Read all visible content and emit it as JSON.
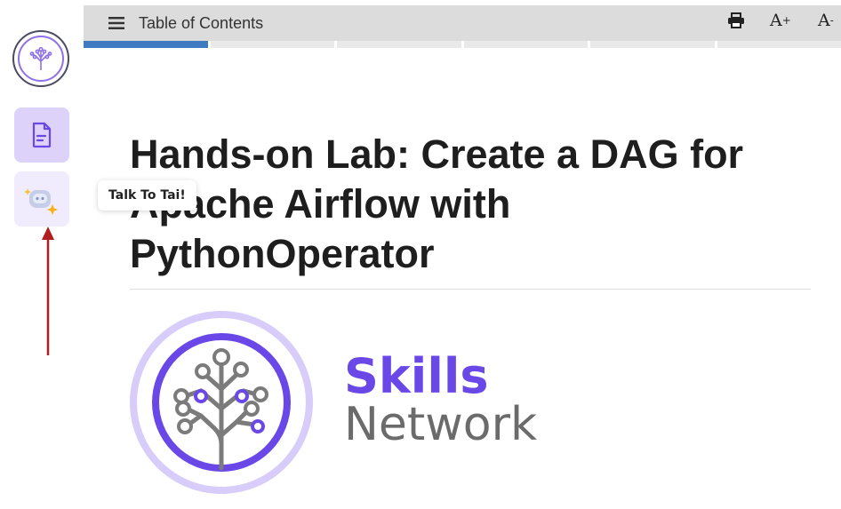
{
  "toolbar": {
    "toc_label": "Table of Contents",
    "increase_font_label": "A",
    "increase_font_sign": "+",
    "decrease_font_label": "A",
    "decrease_font_sign": "-"
  },
  "progress": {
    "segments": 6,
    "active_index": 0
  },
  "sidebar": {
    "tooltip": "Talk To Tai!"
  },
  "content": {
    "title": "Hands-on Lab: Create a DAG for Apache Airflow with PythonOperator",
    "logo_word1": "Skills",
    "logo_word2": "Network"
  },
  "colors": {
    "accent": "#6a48e8",
    "progress_active": "#3e7bc0",
    "arrow": "#b01e1e"
  }
}
